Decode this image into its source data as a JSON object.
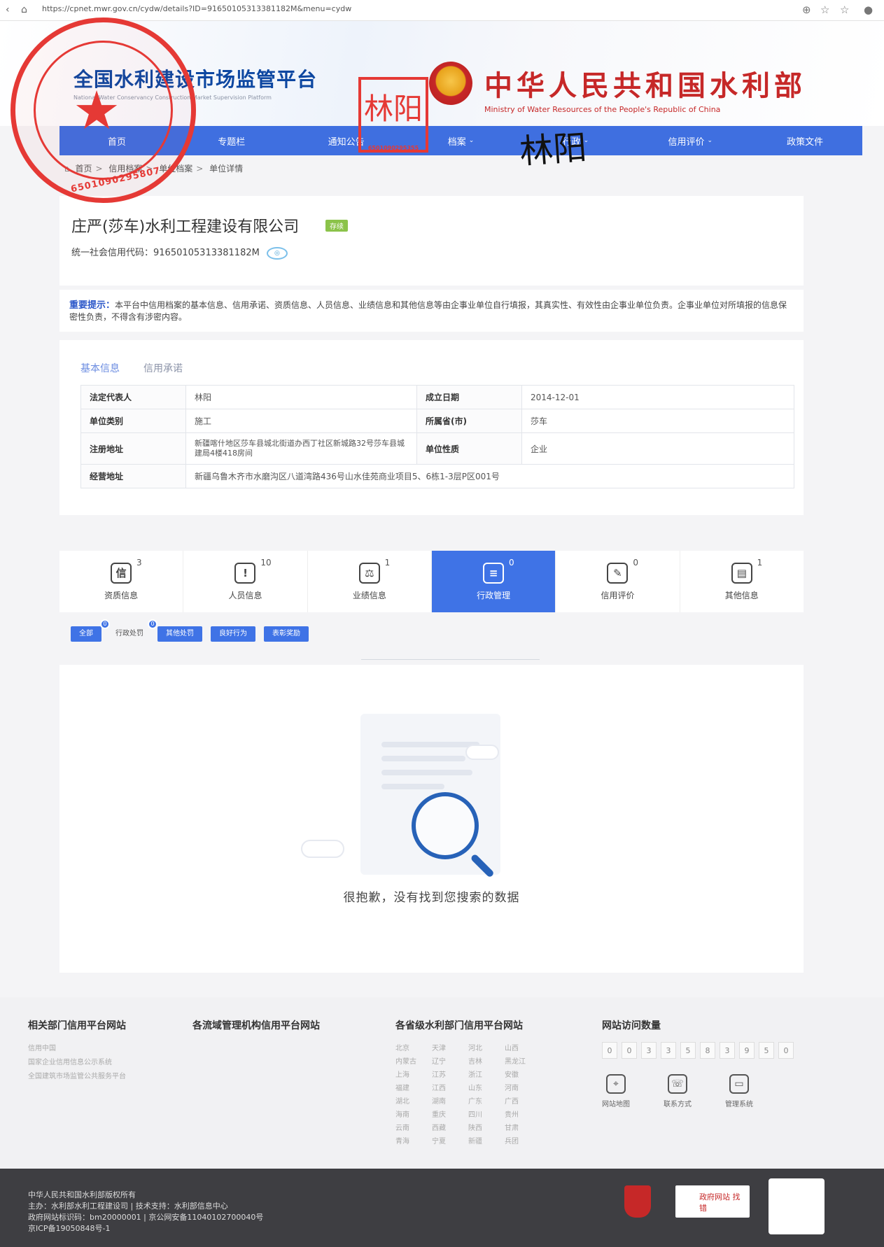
{
  "browser": {
    "url": "https://cpnet.mwr.gov.cn/cydw/details?ID=916501053133811​82M&menu=cydw"
  },
  "header": {
    "platform_title": "全国水利建设市场监管平台",
    "platform_title_en": "National Water Conservancy Construction Market Supervision Platform",
    "ministry_title": "中华人民共和国水利部",
    "ministry_title_en": "Ministry of Water Resources of the People's Republic of China"
  },
  "nav": {
    "items": [
      {
        "label": "首页",
        "dropdown": false
      },
      {
        "label": "专题栏",
        "dropdown": false
      },
      {
        "label": "通知公告",
        "dropdown": false
      },
      {
        "label": "档案",
        "dropdown": true
      },
      {
        "label": "行政",
        "dropdown": true
      },
      {
        "label": "信用评价",
        "dropdown": true
      },
      {
        "label": "政策文件",
        "dropdown": false
      }
    ]
  },
  "breadcrumb": [
    "首页",
    "信用档案",
    "单位档案",
    "单位详情"
  ],
  "company": {
    "name": "庄严(莎车)水利工程建设有限公司",
    "status_tag": "存续",
    "credit_code_label": "统一社会信用代码：",
    "credit_code": "91650105313381182M"
  },
  "notice": {
    "label": "重要提示：",
    "text": "本平台中信用档案的基本信息、信用承诺、资质信息、人员信息、业绩信息和其他信息等由企事业单位自行填报，其真实性、有效性由企事业单位负责。企事业单位对所填报的信息保密性负责，不得含有涉密内容。"
  },
  "basic_info": {
    "tabs": [
      "基本信息",
      "信用承诺"
    ],
    "rows": [
      {
        "k1": "法定代表人",
        "v1": "林阳",
        "k2": "成立日期",
        "v2": "2014-12-01"
      },
      {
        "k1": "单位类别",
        "v1": "施工",
        "k2": "所属省(市)",
        "v2": "莎车"
      },
      {
        "k1": "注册地址",
        "v1": "新疆喀什地区莎车县城北街道办西丁社区新城路32号莎车县城建局4楼418房间",
        "k2": "单位性质",
        "v2": "企业"
      },
      {
        "k1": "经营地址",
        "v1": "新疆乌鲁木齐市水磨沟区八道湾路436号山水佳苑商业项目5、6栋1-3层P区001号"
      }
    ]
  },
  "stats": [
    {
      "icon": "信",
      "count": "3",
      "label": "资质信息",
      "active": false
    },
    {
      "icon": "!",
      "count": "10",
      "label": "人员信息",
      "active": false
    },
    {
      "icon": "⚖",
      "count": "1",
      "label": "业绩信息",
      "active": false
    },
    {
      "icon": "≡",
      "count": "0",
      "label": "行政管理",
      "active": true
    },
    {
      "icon": "✎",
      "count": "0",
      "label": "信用评价",
      "active": false
    },
    {
      "icon": "▤",
      "count": "1",
      "label": "其他信息",
      "active": false
    }
  ],
  "filters": {
    "all": "全部",
    "all_badge": "0",
    "plain": "行政处罚",
    "plain_badge": "0",
    "b1": "其他处罚",
    "b2": "良好行为",
    "b3": "表彰奖励"
  },
  "empty_message": "很抱歉，没有找到您搜索的数据",
  "footer": {
    "col1_title": "相关部门信用平台网站",
    "col1_links": [
      "信用中国",
      "国家企业信用信息公示系统",
      "全国建筑市场监管公共服务平台"
    ],
    "col2_title": "各流域管理机构信用平台网站",
    "col3_title": "各省级水利部门信用平台网站",
    "col3_links": [
      "北京",
      "天津",
      "河北",
      "山西",
      "内蒙古",
      "辽宁",
      "吉林",
      "黑龙江",
      "上海",
      "江苏",
      "浙江",
      "安徽",
      "福建",
      "江西",
      "山东",
      "河南",
      "湖北",
      "湖南",
      "广东",
      "广西",
      "海南",
      "重庆",
      "四川",
      "贵州",
      "云南",
      "西藏",
      "陕西",
      "甘肃",
      "青海",
      "宁夏",
      "新疆",
      "兵团"
    ],
    "col4_title": "网站访问数量",
    "counter": [
      "0",
      "0",
      "3",
      "3",
      "5",
      "8",
      "3",
      "9",
      "5",
      "0"
    ],
    "icons": [
      {
        "icon": "map-pin-icon",
        "label": "网站地图"
      },
      {
        "icon": "chat-icon",
        "label": "联系方式"
      },
      {
        "icon": "monitor-icon",
        "label": "管理系统"
      }
    ],
    "copyright": "中华人民共和国水利部版权所有",
    "sponsor": "主办：水利部水利工程建设司 | 技术支持：水利部信息中心",
    "gov_code": "政府网站标识码：bm20000001 | 京公网安备11040102700040号",
    "icp": "京ICP备19050848号-1",
    "gov_badge": "政府网站 找错"
  },
  "overlays": {
    "seal_number": "6501090295807",
    "name_stamp": "林阳",
    "name_stamp_number": "6501090295355",
    "signature": "林阳"
  }
}
